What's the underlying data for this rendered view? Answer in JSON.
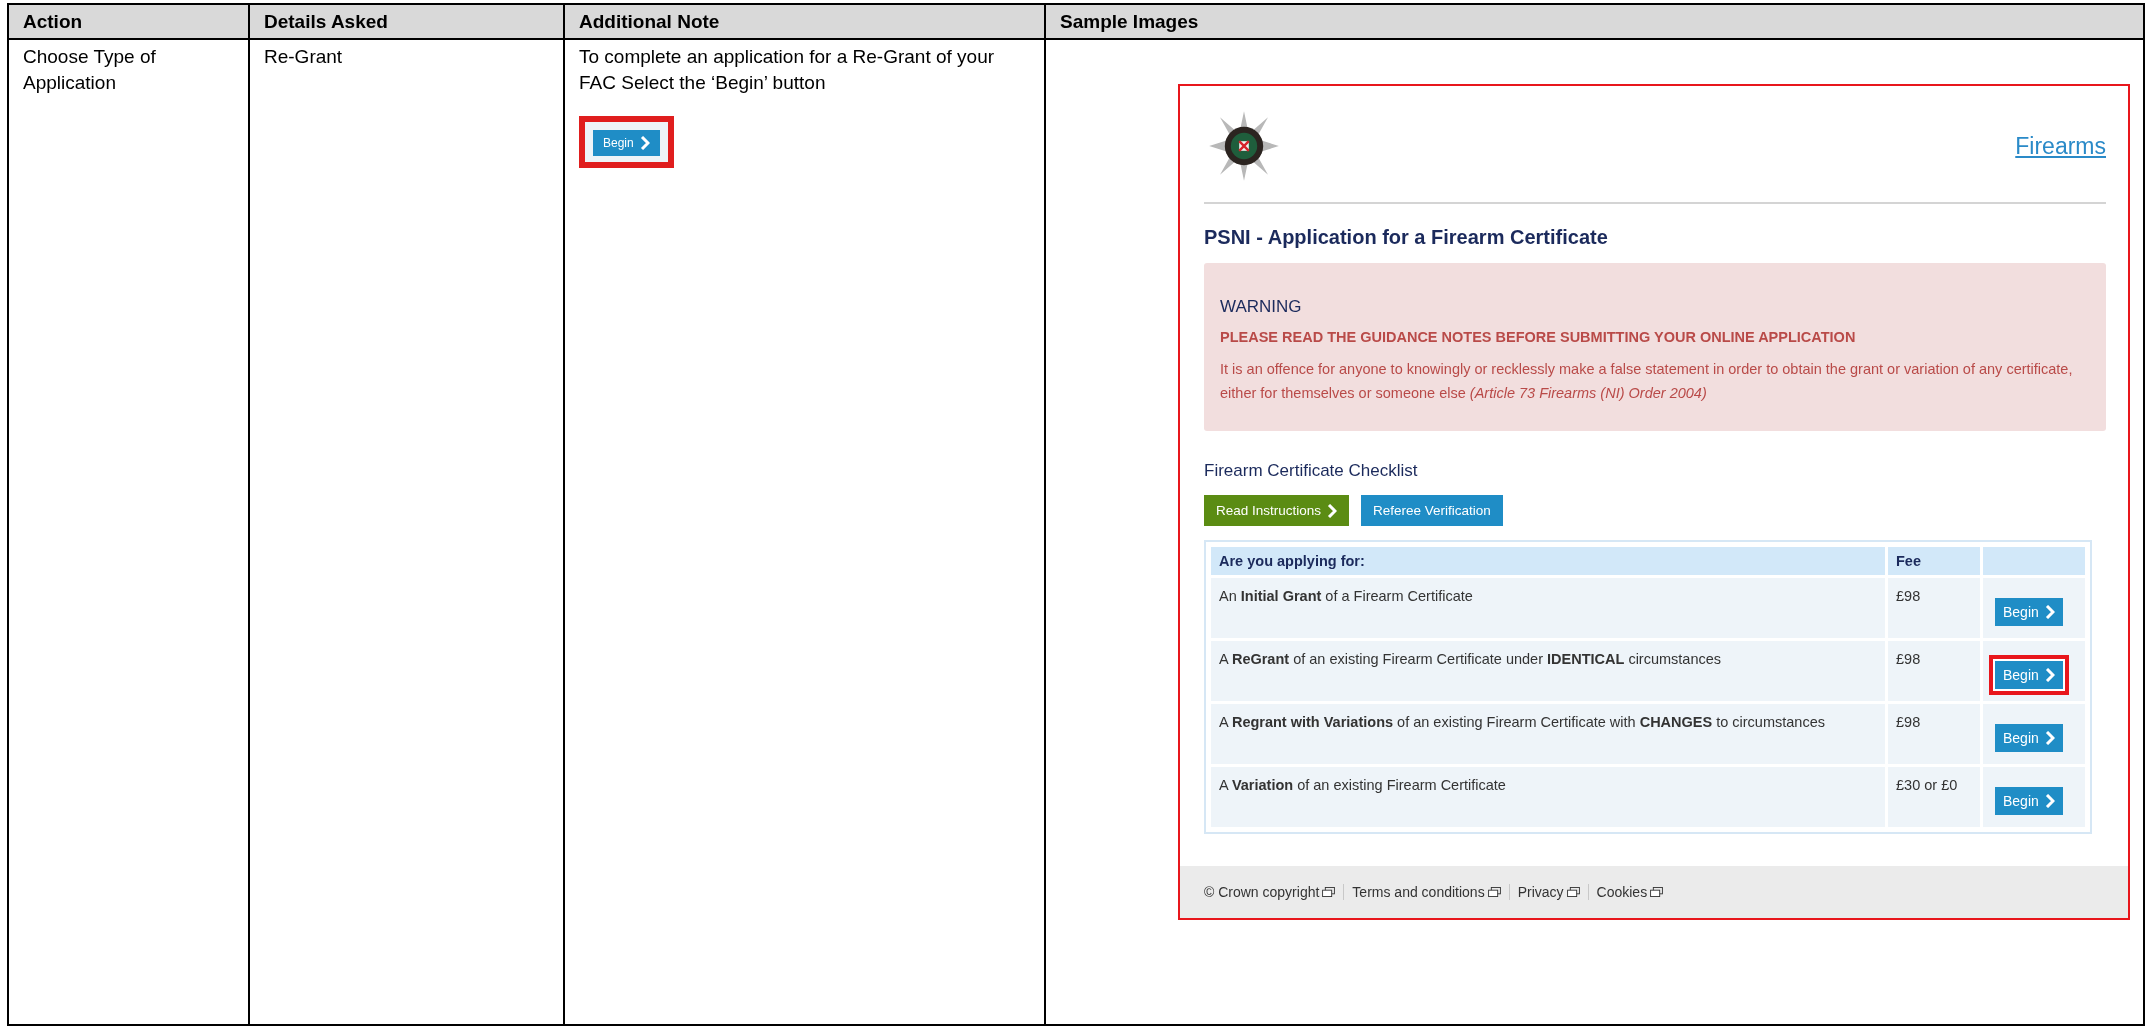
{
  "table": {
    "columns": [
      "Action",
      "Details Asked",
      "Additional Note",
      "Sample Images"
    ],
    "rows": [
      {
        "action": "Choose Type of Application",
        "details": "Re-Grant",
        "note": {
          "text": "To complete an application for a Re-Grant of your FAC Select the ‘Begin’ button",
          "button": {
            "label": "Begin",
            "highlighted": true
          }
        },
        "sample": {
          "header": {
            "link": "Firearms"
          },
          "title": "PSNI - Application for a Firearm Certificate",
          "warning": {
            "heading": "WARNING",
            "notice": "PLEASE READ THE GUIDANCE NOTES BEFORE SUBMITTING YOUR ONLINE APPLICATION",
            "text": "It is an offence for anyone to knowingly or recklessly make a false statement in order to obtain the grant or variation of any certificate, either for themselves or someone else *(Article 73 Firearms (NI) Order 2004)*"
          },
          "checklist": {
            "heading": "Firearm Certificate Checklist",
            "buttons": [
              {
                "label": "Read Instructions",
                "kind": "primary"
              },
              {
                "label": "Referee Verification",
                "kind": "secondary"
              }
            ],
            "columns": [
              "Are you applying for:",
              "Fee"
            ],
            "rows": [
              {
                "description": "An **Initial Grant** of a Firearm Certificate",
                "fee": "£98",
                "button": "Begin",
                "highlighted": false
              },
              {
                "description": "A **ReGrant** of an existing Firearm Certificate under **IDENTICAL** circumstances",
                "fee": "£98",
                "button": "Begin",
                "highlighted": true
              },
              {
                "description": "A **Regrant with Variations** of an existing Firearm Certificate with **CHANGES** to circumstances",
                "fee": "£98",
                "button": "Begin",
                "highlighted": false
              },
              {
                "description": "A **Variation** of an existing Firearm Certificate",
                "fee": "£30 or £0",
                "button": "Begin",
                "highlighted": false
              }
            ]
          },
          "footer": {
            "links": [
              "© Crown copyright",
              "Terms and conditions",
              "Privacy",
              "Cookies"
            ]
          }
        }
      }
    ]
  }
}
